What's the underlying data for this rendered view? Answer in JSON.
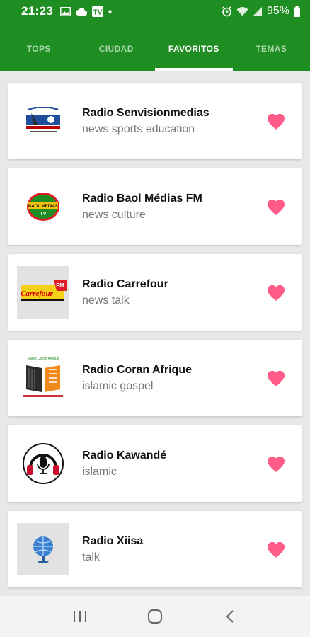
{
  "status": {
    "time": "21:23",
    "battery": "95%"
  },
  "tabs": [
    {
      "label": "TOPS",
      "active": false
    },
    {
      "label": "CIUDAD",
      "active": false
    },
    {
      "label": "FAVORITOS",
      "active": true
    },
    {
      "label": "TEMAS",
      "active": false
    }
  ],
  "stations": [
    {
      "name": "Radio Senvisionmedias",
      "tags": "news sports education",
      "logo_icon": "senvisionmedias-logo-icon",
      "favorite": true
    },
    {
      "name": "Radio Baol Médias FM",
      "tags": "news culture",
      "logo_icon": "baol-medias-logo-icon",
      "logo_text": "BAOL MEDIAS TV",
      "favorite": true
    },
    {
      "name": "Radio Carrefour",
      "tags": "news talk",
      "logo_icon": "carrefour-logo-icon",
      "logo_text": "Carrefour",
      "favorite": true
    },
    {
      "name": "Radio Coran Afrique",
      "tags": "islamic gospel",
      "logo_icon": "coran-afrique-logo-icon",
      "logo_text": "Radio Coran Afrique",
      "favorite": true
    },
    {
      "name": "Radio Kawandé",
      "tags": "islamic",
      "logo_icon": "kawande-logo-icon",
      "favorite": true
    },
    {
      "name": "Radio Xiisa",
      "tags": "talk",
      "logo_icon": "xiisa-logo-icon",
      "favorite": true
    }
  ],
  "colors": {
    "primary": "#1e8e22",
    "heart": "#ff5c8a",
    "background": "#e8e8e8"
  }
}
